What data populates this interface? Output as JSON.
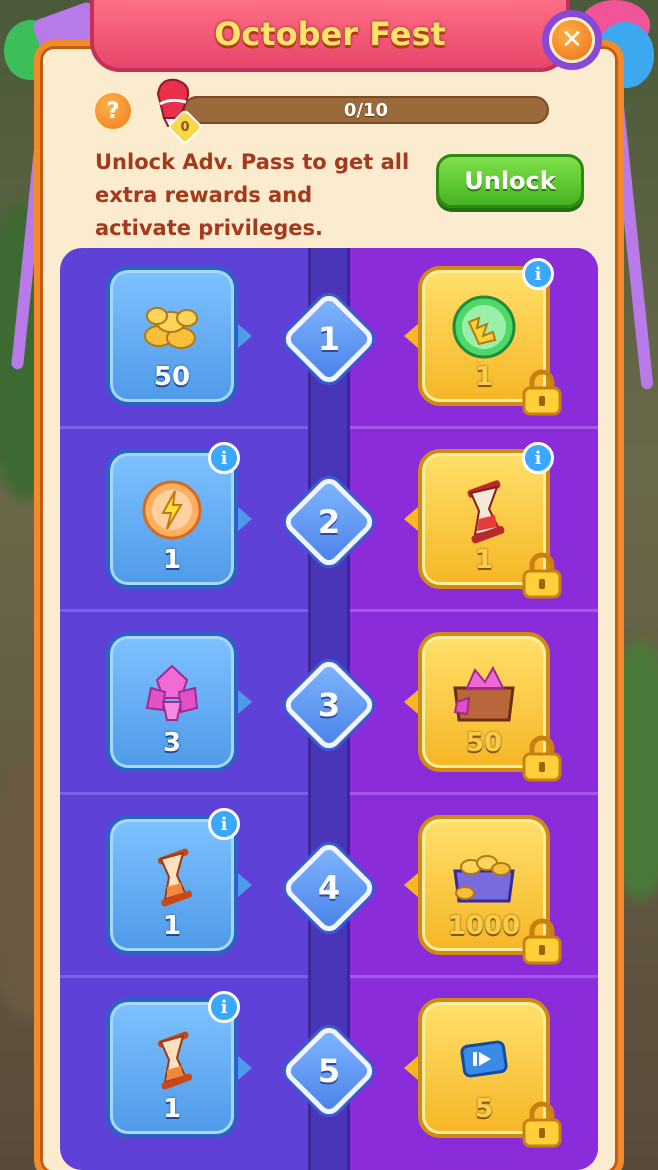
{
  "header": {
    "title": "October Fest",
    "close_glyph": "✕",
    "help_glyph": "?"
  },
  "progress": {
    "current_text": "0/10",
    "fraction": 0.0,
    "flag_count": "0"
  },
  "description": "Unlock Adv. Pass to get all extra rewards and activate privileges.",
  "unlock_button": "Unlock",
  "info_glyph": "i",
  "levels": [
    {
      "level": "1",
      "free": {
        "icon": "gold-coins-icon",
        "count": "50",
        "info": false
      },
      "adv": {
        "icon": "energy-orb-icon",
        "count": "1",
        "info": true
      }
    },
    {
      "level": "2",
      "free": {
        "icon": "lightning-orb-icon",
        "count": "1",
        "info": true
      },
      "adv": {
        "icon": "red-hourglass-icon",
        "count": "1",
        "info": true
      }
    },
    {
      "level": "3",
      "free": {
        "icon": "pink-gems-icon",
        "count": "3",
        "info": false
      },
      "adv": {
        "icon": "gem-chest-icon",
        "count": "50",
        "info": false
      }
    },
    {
      "level": "4",
      "free": {
        "icon": "hourglass-icon",
        "count": "1",
        "info": true
      },
      "adv": {
        "icon": "coin-chest-icon",
        "count": "1000",
        "info": false
      }
    },
    {
      "level": "5",
      "free": {
        "icon": "hourglass-icon",
        "count": "1",
        "info": true
      },
      "adv": {
        "icon": "video-ticket-icon",
        "count": "5",
        "info": false
      }
    }
  ],
  "colors": {
    "free_track": "#5f41d8",
    "adv_track": "#8a2cd9",
    "panel_border": "#f08a2a",
    "title_text": "#ffe26a"
  }
}
